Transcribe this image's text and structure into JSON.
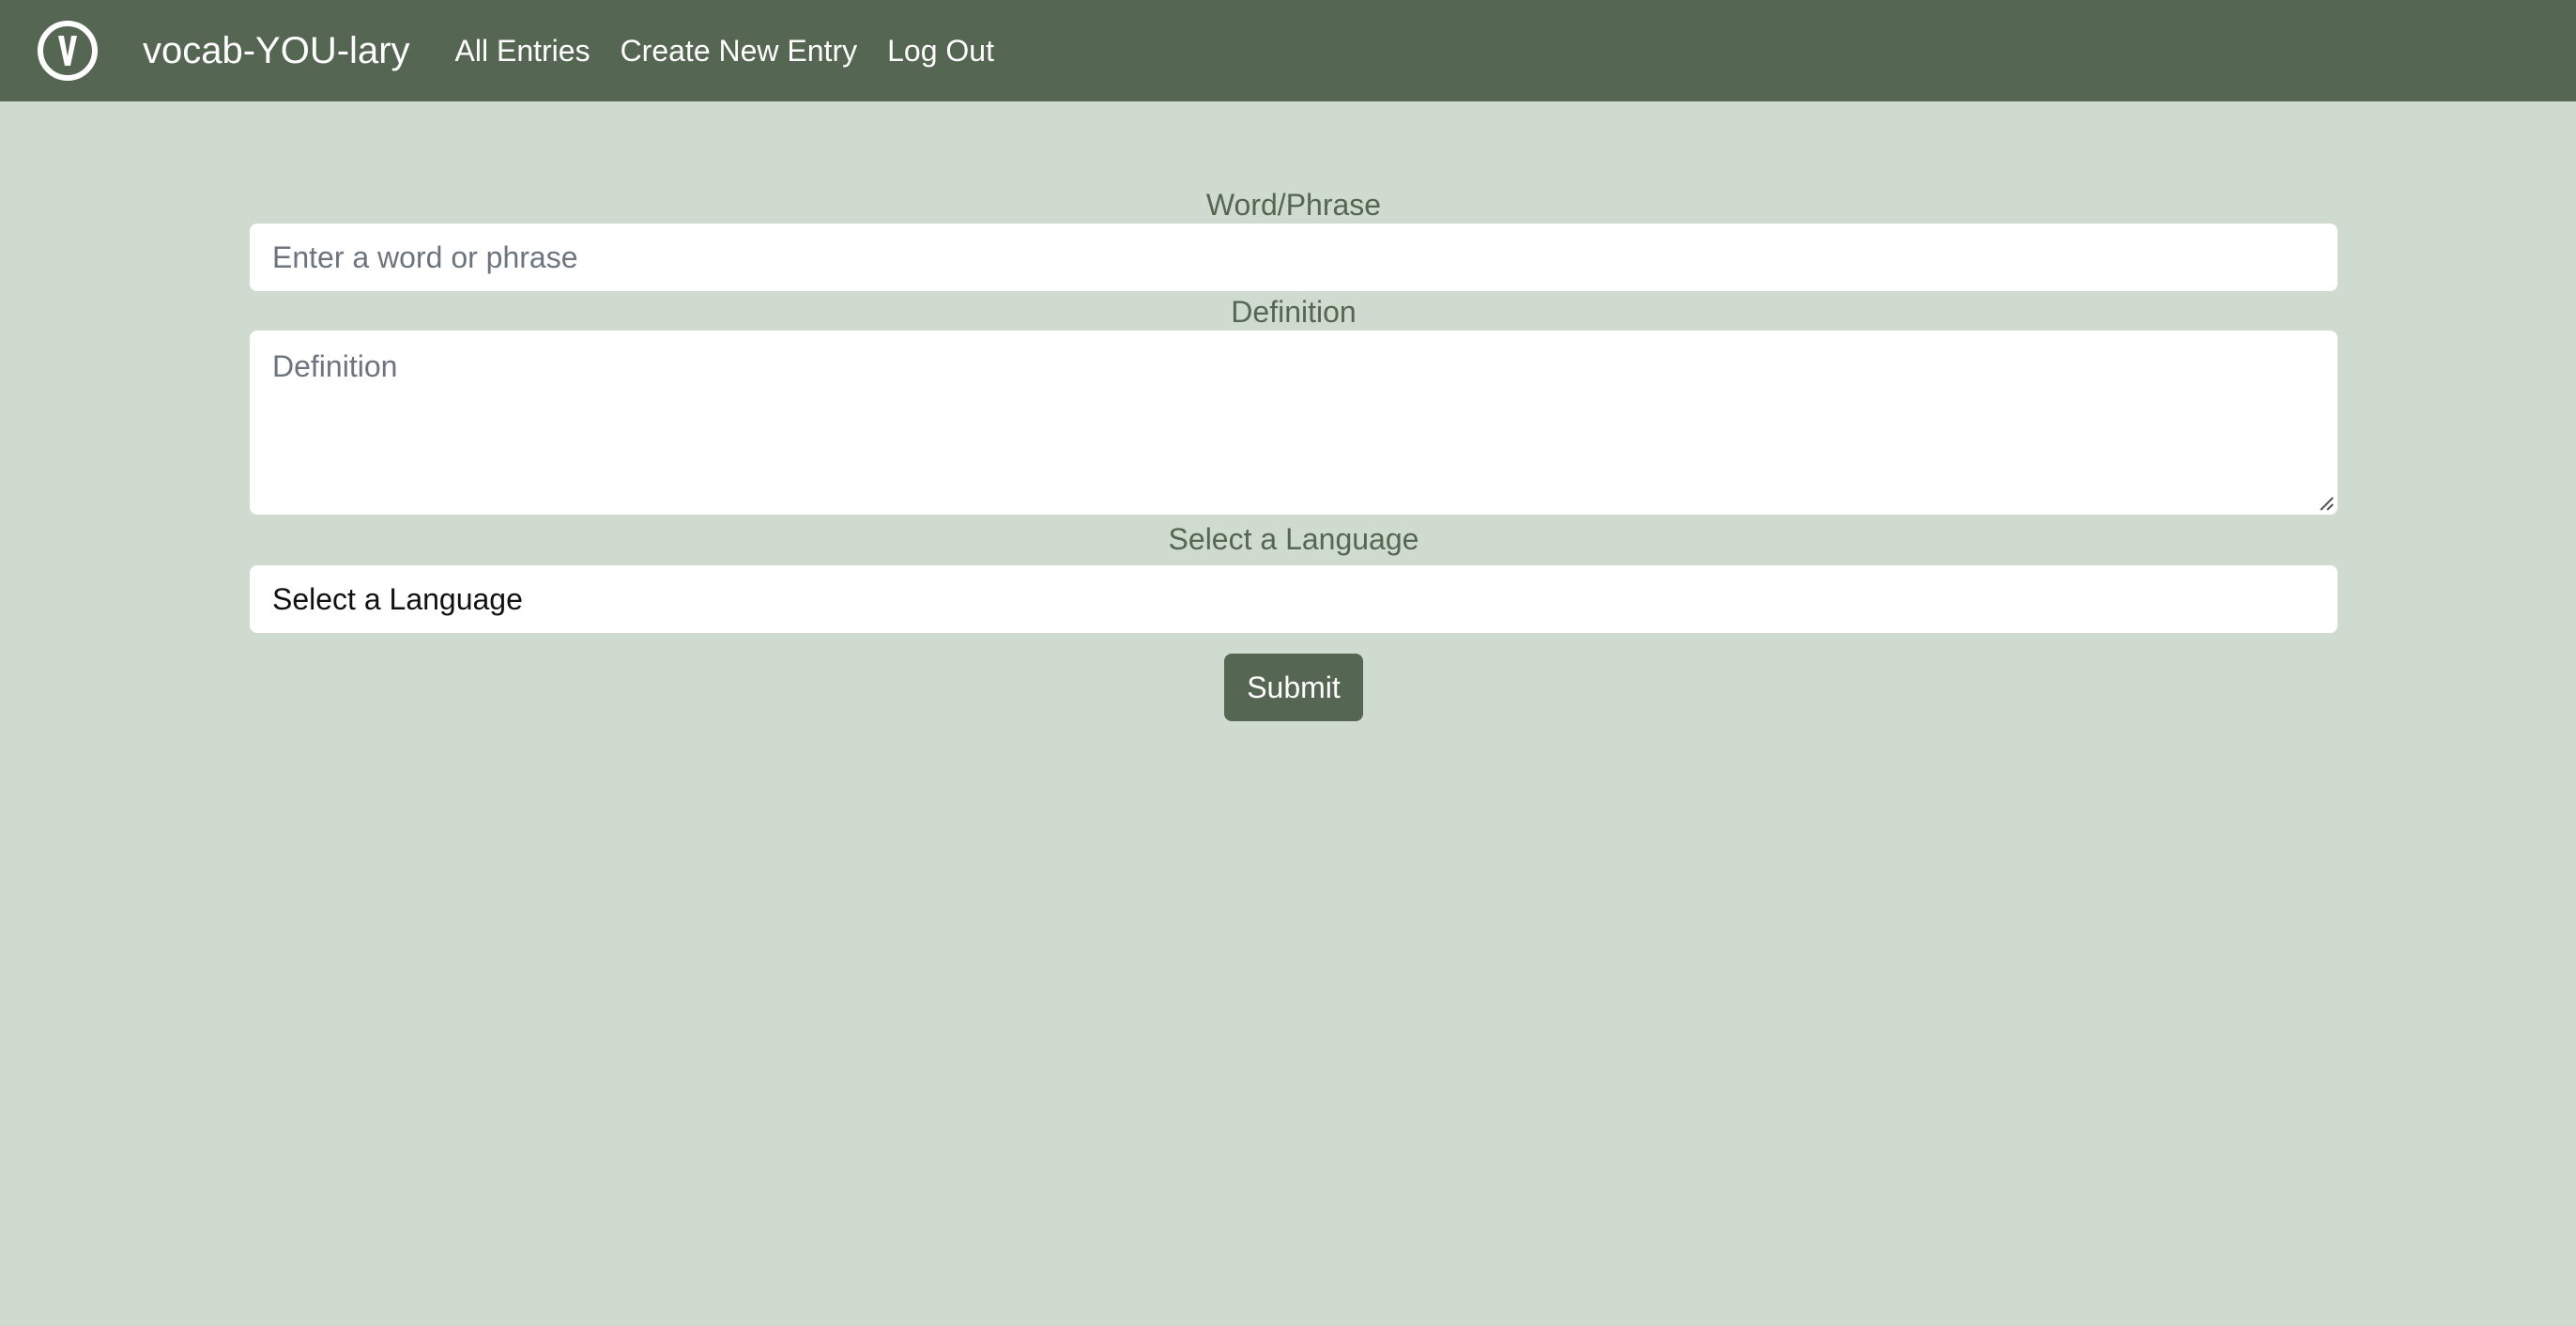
{
  "colors": {
    "navbar_bg": "#556652",
    "page_bg": "#cfdbcf",
    "label_text": "#556652",
    "placeholder_text": "#6c757d",
    "select_text": "#111111",
    "button_bg": "#556652",
    "button_text": "#ffffff",
    "nav_text": "#ffffff"
  },
  "navbar": {
    "logo_icon": "v-circle-logo-icon",
    "logo_letter": "V",
    "brand": "vocab-YOU-lary",
    "links": [
      {
        "label": "All Entries"
      },
      {
        "label": "Create New Entry"
      },
      {
        "label": "Log Out"
      }
    ]
  },
  "form": {
    "word": {
      "label": "Word/Phrase",
      "placeholder": "Enter a word or phrase",
      "value": ""
    },
    "definition": {
      "label": "Definition",
      "placeholder": "Definition",
      "value": ""
    },
    "language": {
      "label": "Select a Language",
      "selected": "Select a Language"
    },
    "submit_label": "Submit"
  }
}
